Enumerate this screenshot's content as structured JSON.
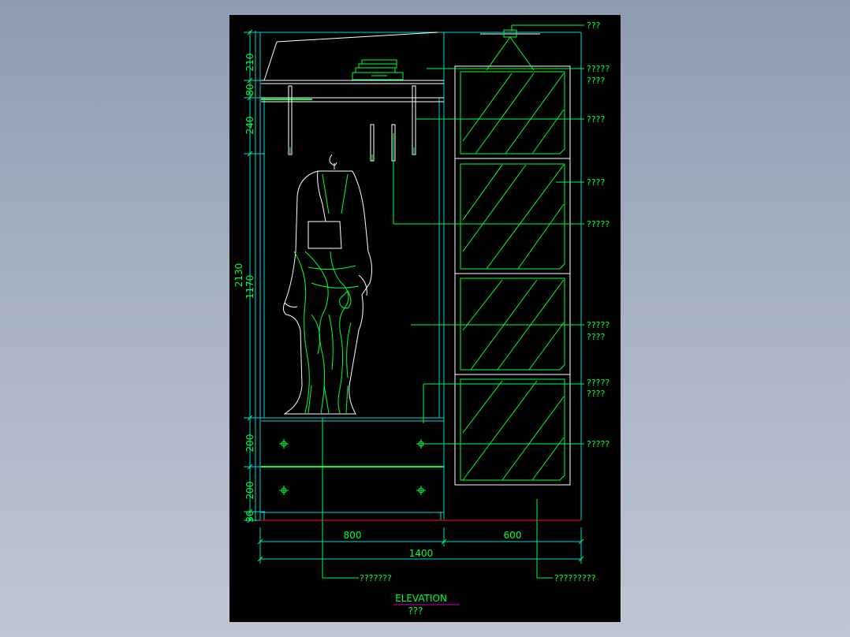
{
  "drawing": {
    "title": "ELEVATION",
    "subtitle": "???",
    "dimensions": {
      "vertical_left": [
        "210",
        "80",
        "240",
        "1170",
        "200",
        "200",
        "30"
      ],
      "vertical_total": "2130",
      "horizontal_segments": [
        "800",
        "600"
      ],
      "horizontal_total": "1400"
    },
    "callouts": [
      "???",
      "?????",
      "????",
      "????",
      "????",
      "?????",
      "?????",
      "????",
      "?????",
      "????",
      "?????",
      "???????",
      "?????????"
    ]
  },
  "colors": {
    "line_cyan": "#00d7d7",
    "line_green": "#00ff3c",
    "line_white": "#ffffff",
    "line_red": "#c00000",
    "title_underline": "#c000c0",
    "sheet_bg": "#000000"
  }
}
